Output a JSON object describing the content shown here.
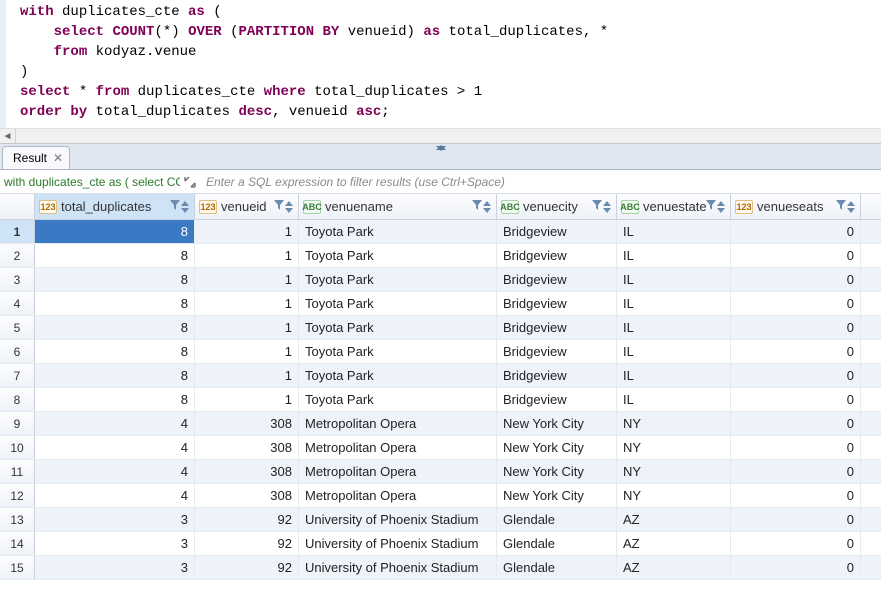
{
  "sql": {
    "l1_kw1": "with",
    "l1_id1": " duplicates_cte ",
    "l1_kw2": "as",
    "l1_rest": " (",
    "l2_pad": "    ",
    "l2_kw1": "select",
    "l2_sp1": " ",
    "l2_fn": "COUNT",
    "l2_mid": "(*) ",
    "l2_kw2": "OVER",
    "l2_sp2": " (",
    "l2_kw3": "PARTITION BY",
    "l2_id1": " venueid) ",
    "l2_kw4": "as",
    "l2_rest": " total_duplicates, *",
    "l3_pad": "    ",
    "l3_kw1": "from",
    "l3_rest": " kodyaz.venue",
    "l4": ")",
    "l5_kw1": "select",
    "l5_mid": " * ",
    "l5_kw2": "from",
    "l5_id1": " duplicates_cte ",
    "l5_kw3": "where",
    "l5_id2": " total_duplicates ",
    "l5_op": ">",
    "l5_num": " 1",
    "l6_kw1": "order by",
    "l6_id1": " total_duplicates ",
    "l6_kw2": "desc",
    "l6_mid": ", venueid ",
    "l6_kw3": "asc",
    "l6_end": ";"
  },
  "tab": {
    "label": "Result",
    "close": "✕"
  },
  "filter": {
    "summary": "with duplicates_cte as ( select COUNT(*) O",
    "placeholder": "Enter a SQL expression to filter results (use Ctrl+Space)"
  },
  "columns": [
    {
      "name": "total_duplicates",
      "type": "num"
    },
    {
      "name": "venueid",
      "type": "num"
    },
    {
      "name": "venuename",
      "type": "txt"
    },
    {
      "name": "venuecity",
      "type": "txt"
    },
    {
      "name": "venuestate",
      "type": "txt"
    },
    {
      "name": "venueseats",
      "type": "num"
    }
  ],
  "rows": [
    {
      "n": "1",
      "v": [
        "8",
        "1",
        "Toyota Park",
        "Bridgeview",
        "IL",
        "0"
      ]
    },
    {
      "n": "2",
      "v": [
        "8",
        "1",
        "Toyota Park",
        "Bridgeview",
        "IL",
        "0"
      ]
    },
    {
      "n": "3",
      "v": [
        "8",
        "1",
        "Toyota Park",
        "Bridgeview",
        "IL",
        "0"
      ]
    },
    {
      "n": "4",
      "v": [
        "8",
        "1",
        "Toyota Park",
        "Bridgeview",
        "IL",
        "0"
      ]
    },
    {
      "n": "5",
      "v": [
        "8",
        "1",
        "Toyota Park",
        "Bridgeview",
        "IL",
        "0"
      ]
    },
    {
      "n": "6",
      "v": [
        "8",
        "1",
        "Toyota Park",
        "Bridgeview",
        "IL",
        "0"
      ]
    },
    {
      "n": "7",
      "v": [
        "8",
        "1",
        "Toyota Park",
        "Bridgeview",
        "IL",
        "0"
      ]
    },
    {
      "n": "8",
      "v": [
        "8",
        "1",
        "Toyota Park",
        "Bridgeview",
        "IL",
        "0"
      ]
    },
    {
      "n": "9",
      "v": [
        "4",
        "308",
        "Metropolitan Opera",
        "New York City",
        "NY",
        "0"
      ]
    },
    {
      "n": "10",
      "v": [
        "4",
        "308",
        "Metropolitan Opera",
        "New York City",
        "NY",
        "0"
      ]
    },
    {
      "n": "11",
      "v": [
        "4",
        "308",
        "Metropolitan Opera",
        "New York City",
        "NY",
        "0"
      ]
    },
    {
      "n": "12",
      "v": [
        "4",
        "308",
        "Metropolitan Opera",
        "New York City",
        "NY",
        "0"
      ]
    },
    {
      "n": "13",
      "v": [
        "3",
        "92",
        "University of Phoenix Stadium",
        "Glendale",
        "AZ",
        "0"
      ]
    },
    {
      "n": "14",
      "v": [
        "3",
        "92",
        "University of Phoenix Stadium",
        "Glendale",
        "AZ",
        "0"
      ]
    },
    {
      "n": "15",
      "v": [
        "3",
        "92",
        "University of Phoenix Stadium",
        "Glendale",
        "AZ",
        "0"
      ]
    }
  ],
  "type_labels": {
    "num": "123",
    "txt": "ABC"
  },
  "scroll_arrow": "◄",
  "selected_row": 0,
  "selected_col": 0
}
